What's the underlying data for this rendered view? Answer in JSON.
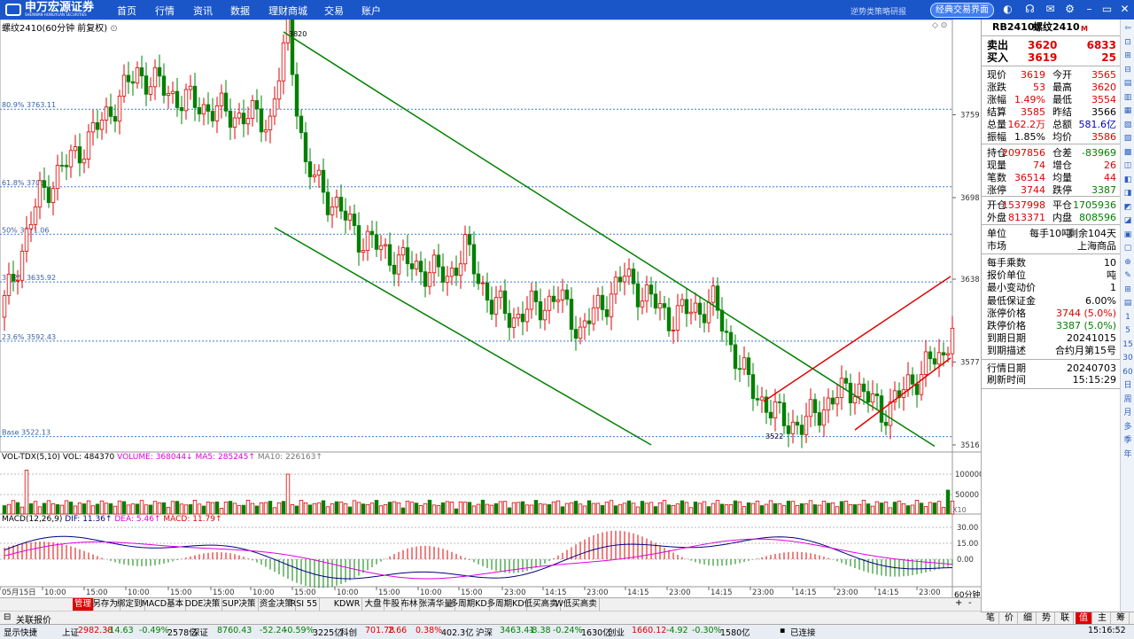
{
  "header": {
    "logo_text": "申万宏源证券",
    "logo_sub": "SHENWAN HONGYUAN SECURITIES",
    "nav": [
      "首页",
      "行情",
      "资讯",
      "数据",
      "理财商城",
      "交易",
      "账户"
    ],
    "scroll_text": "逆势类策略研报",
    "classic_button": "经典交易界面",
    "icons": [
      "skin-icon",
      "headset-icon",
      "mail-icon",
      "settings-icon",
      "minimize-icon",
      "restore-icon",
      "close-icon"
    ]
  },
  "chart": {
    "title": "螺纹2410(60分钟 前复权)",
    "fib_labels": [
      "80.9% 3763.11",
      "61.8% 3706",
      "50% 3671.06",
      "38.2% 3635.92",
      "23.6% 3592.43",
      "Base 3522.13"
    ],
    "high_label": "3820",
    "low_label": "3522",
    "price_axis": [
      "3759",
      "3698",
      "3638",
      "3577",
      "3516"
    ],
    "volume_title": "VOL-TDX(5,10)",
    "vol_values": {
      "vol": "VOL: 484370",
      "volume": "VOLUME: 368044↓",
      "ma5": "MA5: 285245↑",
      "ma10": "MA10: 226163↑"
    },
    "volume_axis": [
      "100000",
      "50000"
    ],
    "volume_unit": "X10",
    "macd_title": "MACD(12,26,9)",
    "macd_values": {
      "dif": "DIF: 11.36↑",
      "dea": "DEA: 5.46↑",
      "macd": "MACD: 11.79↑"
    },
    "macd_axis": [
      "30.00",
      "15.00",
      "0.00"
    ],
    "time_axis": [
      "05月15日",
      "10:00",
      "15:00",
      "10:00",
      "15:00",
      "15:00",
      "10:00",
      "15:00",
      "10:00",
      "15:00",
      "10:00",
      "15:00",
      "23:00",
      "14:15",
      "23:00",
      "14:15",
      "23:00",
      "14:15",
      "23:00",
      "14:15",
      "23:00",
      "14:15",
      "23:00"
    ],
    "period": "60分钟",
    "colors": {
      "up": "#e00000",
      "down": "#008000",
      "trend": "#008000",
      "rising": "#e00000",
      "fib": "#3a7bd5",
      "dif": "#000080",
      "dea": "#e000e0"
    }
  },
  "quote": {
    "code": "RB2410",
    "name": "螺纹2410",
    "badge": "M",
    "sell_label": "卖出",
    "sell_price": "3620",
    "sell_vol": "6833",
    "buy_label": "买入",
    "buy_price": "3619",
    "buy_vol": "25",
    "block1": [
      [
        "现价",
        "3619",
        "今开",
        "3565"
      ],
      [
        "涨跌",
        "53",
        "最高",
        "3620"
      ],
      [
        "涨幅",
        "1.49%",
        "最低",
        "3554"
      ],
      [
        "结算",
        "3585",
        "昨结",
        "3566"
      ],
      [
        "总量",
        "162.2万",
        "总额",
        "581.6亿"
      ],
      [
        "振幅",
        "1.85%",
        "均价",
        "3586"
      ]
    ],
    "block2": [
      [
        "持仓",
        "2097856",
        "仓差",
        "-83969"
      ],
      [
        "现量",
        "74",
        "增仓",
        "26"
      ],
      [
        "笔数",
        "36514",
        "均量",
        "44"
      ],
      [
        "涨停",
        "3744",
        "跌停",
        "3387"
      ]
    ],
    "block3": [
      [
        "开仓",
        "1537998",
        "平仓",
        "1705936"
      ],
      [
        "外盘",
        "813371",
        "内盘",
        "808596"
      ]
    ],
    "unit_label": "单位",
    "unit_value": "每手10吨",
    "remain": "剩余104天",
    "market_label": "市场",
    "market_value": "上海商品",
    "details": [
      [
        "每手乘数",
        "10"
      ],
      [
        "报价单位",
        "吨"
      ],
      [
        "最小变动价",
        "1"
      ],
      [
        "最低保证金",
        "6.00%"
      ],
      [
        "涨停价格",
        "3744 (5.0%)"
      ],
      [
        "跌停价格",
        "3387 (5.0%)"
      ],
      [
        "到期日期",
        "20241015"
      ],
      [
        "到期描述",
        "合约月第15号"
      ]
    ],
    "quote_date_label": "行情日期",
    "quote_date": "20240703",
    "refresh_label": "刷新时间",
    "refresh_time": "15:15:29"
  },
  "tabs": [
    "管理",
    "另存为",
    "绑定到",
    "MACD基本",
    "DDE决策",
    "SUP决策",
    "资金决策",
    "RSI 55",
    "KDWR",
    "大盘",
    "牛股",
    "布林",
    "张清华量",
    "多周期KD",
    "多周期KD",
    "低买高卖",
    "W低买高卖"
  ],
  "quick_label": "关联报价",
  "mini_tabs": [
    "笔",
    "价",
    "细",
    "势",
    "联",
    "值",
    "主",
    "筹"
  ],
  "status": {
    "items": [
      "显示快捷",
      "上证",
      "2982.38",
      "-14.63",
      "-0.49%",
      "2578亿",
      "深证",
      "8760.43",
      "-52.24",
      "-0.59%",
      "3225亿",
      "科创",
      "701.78",
      "2.66",
      "0.38%",
      "402.3亿",
      "沪深",
      "3463.41",
      "-8.38",
      "-0.24%",
      "1630亿",
      "创业",
      "1660.12",
      "-4.92",
      "-0.30%",
      "1580亿"
    ],
    "connected": "已连接",
    "time": "15:16:52"
  }
}
